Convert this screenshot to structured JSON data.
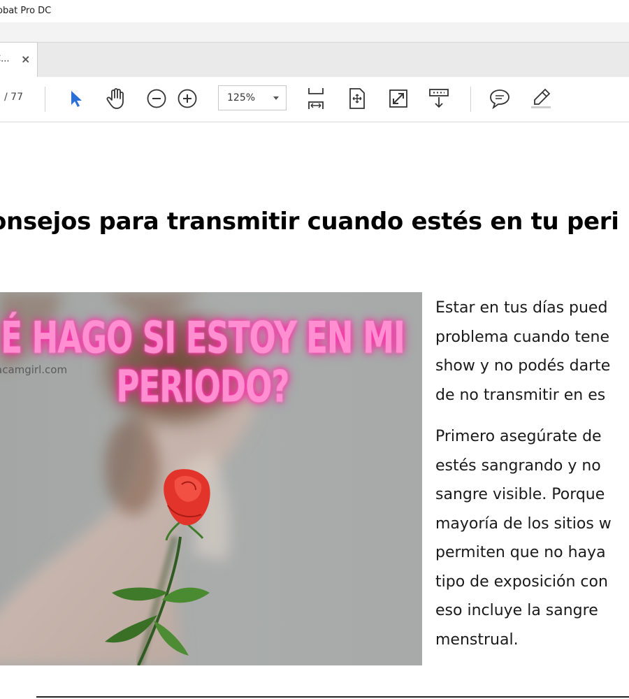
{
  "window": {
    "title": "obat Pro DC"
  },
  "tab": {
    "label": "C...",
    "close": "×"
  },
  "toolbar": {
    "page_count": "/ 77",
    "zoom": "125%",
    "tools": [
      "select-icon",
      "hand-icon",
      "zoom-out-icon",
      "zoom-in-icon",
      "fit-width-icon",
      "fit-page-icon",
      "fullscreen-icon",
      "scroll-mode-icon",
      "comment-icon",
      "highlight-icon"
    ],
    "accent": "#2c6fd6"
  },
  "document": {
    "heading": "onsejos para transmitir cuando estés en tu peri",
    "image": {
      "headline_line1": "É HAGO SI ESTOY EN MI",
      "headline_line2": "PERIODO?",
      "watermark": "acamgirl.com",
      "neon_color": "#ff3fb4"
    },
    "paragraphs": [
      [
        "Estar en tus días pued",
        "problema cuando tene",
        "show y no podés darte",
        "de no transmitir en es"
      ],
      [
        "Primero asegúrate de",
        "estés sangrando y no",
        "sangre visible. Porque",
        "mayoría de los sitios w",
        "permiten que no haya",
        "tipo de exposición con",
        "eso incluye la sangre",
        "menstrual."
      ]
    ]
  }
}
